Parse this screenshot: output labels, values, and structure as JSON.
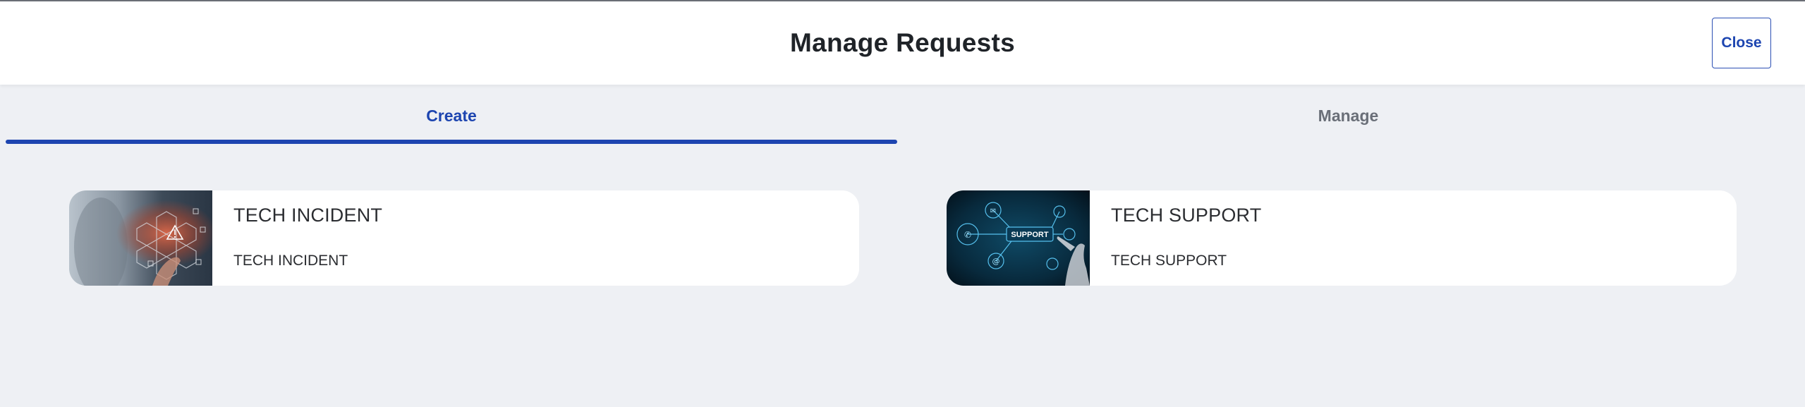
{
  "header": {
    "title": "Manage Requests",
    "close_label": "Close"
  },
  "tabs": [
    {
      "label": "Create",
      "active": true
    },
    {
      "label": "Manage",
      "active": false
    }
  ],
  "cards": [
    {
      "title": "TECH INCIDENT",
      "description": "TECH INCIDENT",
      "image": "warning-hexagon-image"
    },
    {
      "title": "TECH SUPPORT",
      "description": "TECH SUPPORT",
      "image": "support-network-image",
      "image_text": "SUPPORT"
    }
  ],
  "colors": {
    "accent": "#1d45b0",
    "background": "#eef0f4",
    "inactive_tab": "#6a6f78",
    "card": "#ffffff"
  }
}
